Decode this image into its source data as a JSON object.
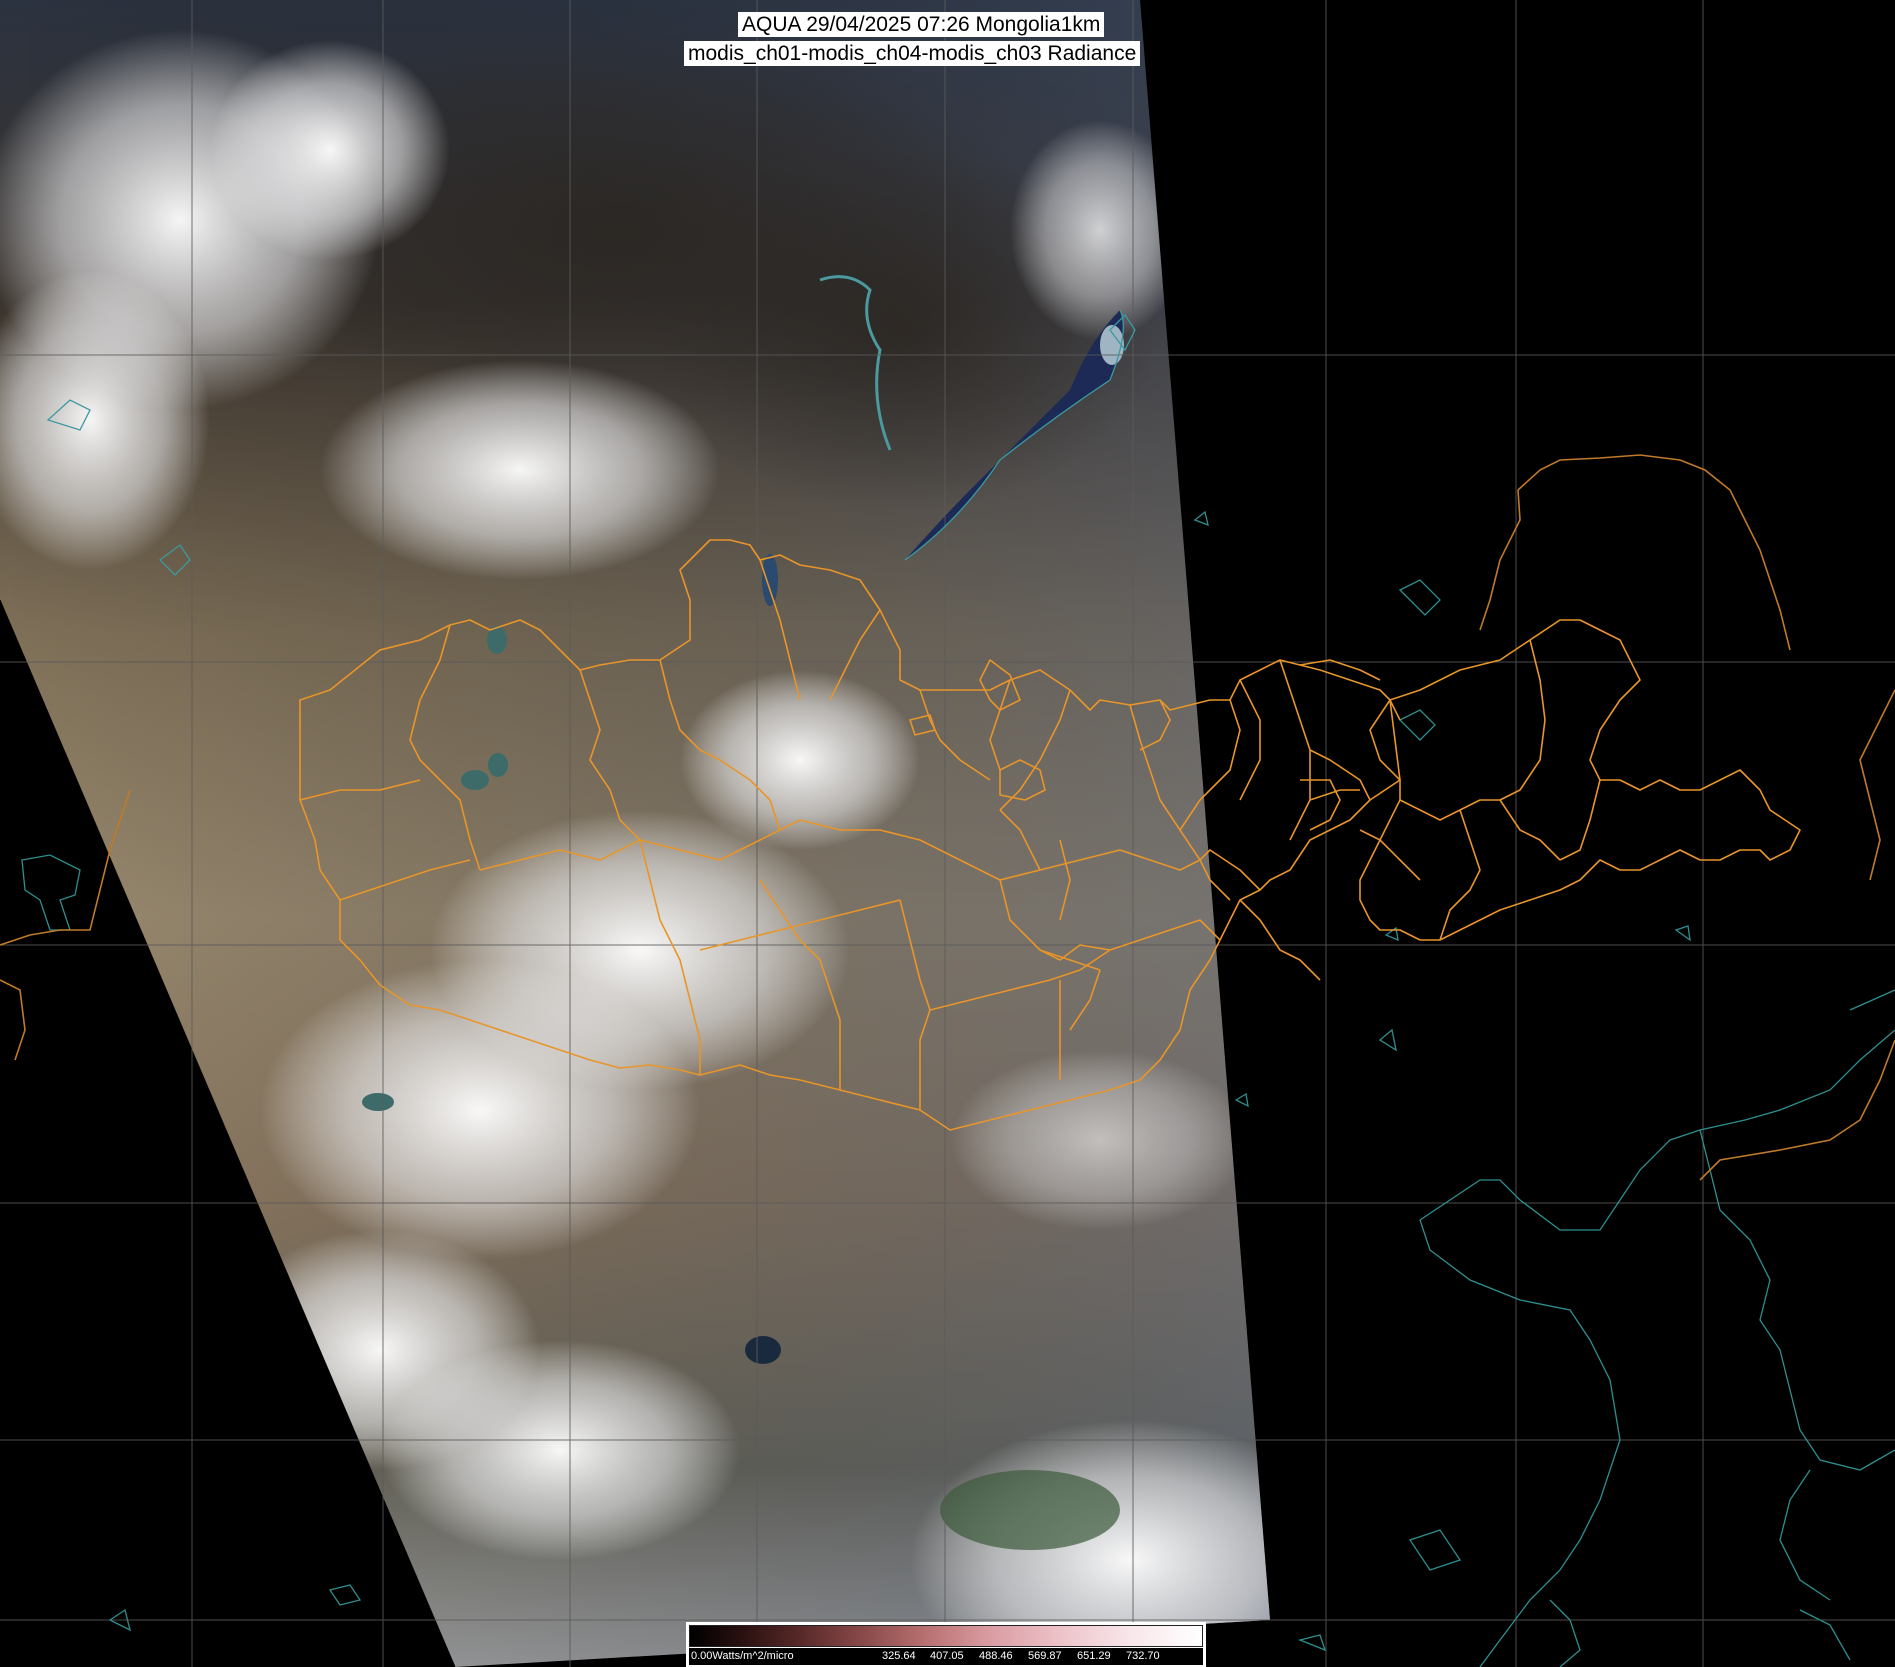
{
  "header": {
    "title": "AQUA 29/04/2025 07:26 Mongolia1km",
    "subtitle": "modis_ch01-modis_ch04-modis_ch03 Radiance"
  },
  "colorbar": {
    "min_label": "0.00Watts/m^2/micro",
    "ticks": [
      "325.64",
      "407.05",
      "488.46",
      "569.87",
      "651.29",
      "732.70"
    ]
  },
  "colors": {
    "background": "#000000",
    "grid": "#5a5a5a",
    "border_lines": "#e8952a",
    "coastline": "#2f8f8f",
    "label_box": "#ffffff"
  },
  "layers": [
    "satellite-swath",
    "lat-lon-grid",
    "country-borders",
    "province-borders",
    "coastlines",
    "lakes"
  ]
}
